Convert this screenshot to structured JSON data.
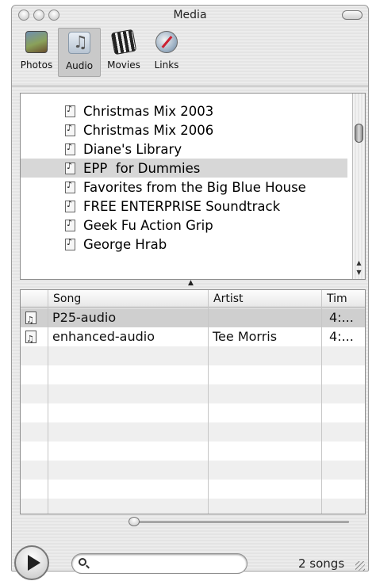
{
  "window": {
    "title": "Media"
  },
  "toolbar": {
    "tabs": [
      {
        "label": "Photos",
        "icon": "photos-icon",
        "selected": false
      },
      {
        "label": "Audio",
        "icon": "audio-icon",
        "selected": true
      },
      {
        "label": "Movies",
        "icon": "movies-icon",
        "selected": false
      },
      {
        "label": "Links",
        "icon": "links-icon",
        "selected": false
      }
    ]
  },
  "library": {
    "items": [
      {
        "label": "Christmas Mix 2003",
        "selected": false
      },
      {
        "label": "Christmas Mix 2006",
        "selected": false
      },
      {
        "label": "Diane's Library",
        "selected": false
      },
      {
        "label": "EPP  for Dummies",
        "selected": true
      },
      {
        "label": "Favorites from the Big Blue House",
        "selected": false
      },
      {
        "label": "FREE ENTERPRISE Soundtrack",
        "selected": false
      },
      {
        "label": "Geek Fu Action Grip",
        "selected": false
      },
      {
        "label": "George Hrab",
        "selected": false
      }
    ]
  },
  "songs": {
    "columns": {
      "song": "Song",
      "artist": "Artist",
      "time": "Tim"
    },
    "rows": [
      {
        "song": "P25-audio",
        "artist": "",
        "time": "4:...",
        "selected": true
      },
      {
        "song": "enhanced-audio",
        "artist": "Tee Morris",
        "time": "4:...",
        "selected": false
      }
    ]
  },
  "footer": {
    "search_placeholder": "",
    "song_count": "2 songs"
  },
  "colors": {
    "selection": "#d7d7d7",
    "window_bg": "#e8e8e8"
  }
}
